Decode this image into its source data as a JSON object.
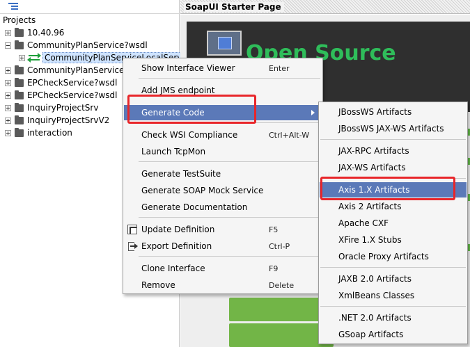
{
  "navigator": {
    "toolbar_icon": "list-tree-icon",
    "root_label": "Projects",
    "items": [
      {
        "label": "10.40.96",
        "expander": "plus"
      },
      {
        "label": "CommunityPlanService?wsdl",
        "expander": "minus"
      },
      {
        "label": "CommunityPlanServiceLocalServi",
        "expander": "plus",
        "selected": true,
        "icon": "interface-icon"
      },
      {
        "label": "CommunityPlanService",
        "expander": "plus"
      },
      {
        "label": "EPCheckService?wsdl",
        "expander": "plus"
      },
      {
        "label": "EPCheckService?wsdl",
        "expander": "plus"
      },
      {
        "label": "InquiryProjectSrv",
        "expander": "plus"
      },
      {
        "label": "InquiryProjectSrvV2",
        "expander": "plus"
      },
      {
        "label": "interaction",
        "expander": "plus"
      }
    ]
  },
  "starter": {
    "title": "SoapUI Starter Page",
    "hero_text": "Open Source"
  },
  "context_menu": {
    "items": [
      {
        "label": "Show Interface Viewer",
        "shortcut": "Enter"
      },
      {
        "label": "Add JMS endpoint",
        "shortcut": ""
      },
      {
        "label": "Generate Code",
        "shortcut": "",
        "submenu": true,
        "hover": true
      },
      {
        "label": "Check WSI Compliance",
        "shortcut": "Ctrl+Alt-W"
      },
      {
        "label": "Launch TcpMon",
        "shortcut": ""
      },
      {
        "label": "Generate TestSuite",
        "shortcut": ""
      },
      {
        "label": "Generate SOAP Mock Service",
        "shortcut": ""
      },
      {
        "label": "Generate Documentation",
        "shortcut": ""
      },
      {
        "label": "Update Definition",
        "shortcut": "F5",
        "icon": "update-definition-icon"
      },
      {
        "label": "Export Definition",
        "shortcut": "Ctrl-P",
        "icon": "export-definition-icon"
      },
      {
        "label": "Clone Interface",
        "shortcut": "F9"
      },
      {
        "label": "Remove",
        "shortcut": "Delete"
      }
    ]
  },
  "generate_code_submenu": {
    "items": [
      {
        "label": "JBossWS Artifacts"
      },
      {
        "label": "JBossWS JAX-WS Artifacts"
      },
      {
        "label": "JAX-RPC Artifacts"
      },
      {
        "label": "JAX-WS Artifacts"
      },
      {
        "label": "Axis 1.X Artifacts",
        "hover": true
      },
      {
        "label": "Axis 2 Artifacts"
      },
      {
        "label": "Apache CXF"
      },
      {
        "label": "XFire 1.X Stubs"
      },
      {
        "label": "Oracle Proxy Artifacts"
      },
      {
        "label": "JAXB 2.0 Artifacts"
      },
      {
        "label": "XmlBeans Classes"
      },
      {
        "label": ".NET 2.0 Artifacts"
      },
      {
        "label": "GSoap Artifacts"
      }
    ]
  },
  "colors": {
    "menu_hover": "#5b79b8",
    "highlight_box": "#e8262a",
    "hero_text": "#2fbd5a",
    "green_button": "#72b547"
  }
}
